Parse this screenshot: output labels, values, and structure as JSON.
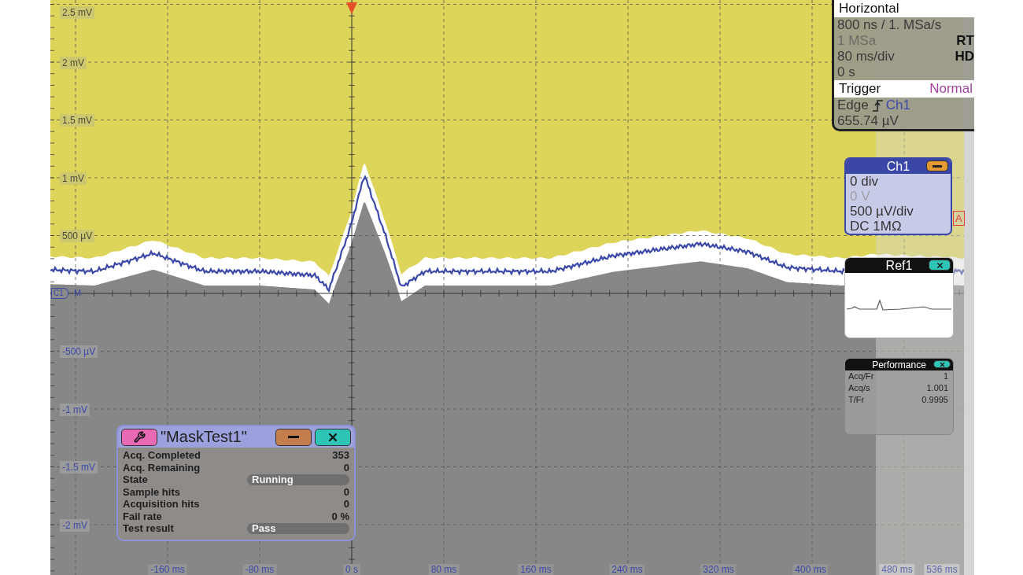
{
  "display": {
    "y_labels_upper": [
      "2.5 mV",
      "2 mV",
      "1.5 mV",
      "1 mV",
      "500 µV"
    ],
    "y_labels_lower": [
      "-500 µV",
      "-1 mV",
      "-1.5 mV",
      "-2 mV"
    ],
    "x_labels": [
      {
        "text": "-160 ms",
        "dim": false
      },
      {
        "text": "-80 ms",
        "dim": false
      },
      {
        "text": "0 s",
        "dim": false
      },
      {
        "text": "80 ms",
        "dim": false
      },
      {
        "text": "160 ms",
        "dim": false
      },
      {
        "text": "240 ms",
        "dim": false
      },
      {
        "text": "320 ms",
        "dim": false
      },
      {
        "text": "400 ms",
        "dim": false
      },
      {
        "text": "480 ms",
        "dim": true
      },
      {
        "text": "536 ms",
        "dim": true
      }
    ],
    "channel_marker": "C1",
    "ground_marker": "M",
    "trigger_marker": "A"
  },
  "horizontal": {
    "title": "Horizontal",
    "rows": [
      {
        "left": "800 ns / 1. MSa/s",
        "dim": false
      },
      {
        "left": "1 MSa",
        "right": "RT",
        "dim": true
      },
      {
        "left": "80 ms/div",
        "right": "HD",
        "dim": false
      },
      {
        "left": "0 s",
        "dim": false
      }
    ]
  },
  "trigger": {
    "title": "Trigger",
    "mode": "Normal",
    "type": "Edge",
    "source": "Ch1",
    "threshold": "655.74 µV"
  },
  "ch1": {
    "title": "Ch1",
    "rows": [
      {
        "text": "0 div",
        "dim": false
      },
      {
        "text": "0 V",
        "dim": true
      },
      {
        "text": "500 µV/div",
        "dim": false
      },
      {
        "text": "DC 1MΩ",
        "dim": false
      }
    ]
  },
  "ref1": {
    "title": "Ref1"
  },
  "performance": {
    "title": "Performance",
    "rows": [
      {
        "label": "Acq/Fr",
        "value": "1"
      },
      {
        "label": "Acq/s",
        "value": "1.001"
      },
      {
        "label": "T/Fr",
        "value": "0.9995"
      }
    ]
  },
  "mask_test": {
    "title": "\"MaskTest1\"",
    "rows": [
      {
        "label": "Acq. Completed",
        "value": "353",
        "kind": "value"
      },
      {
        "label": "Acq. Remaining",
        "value": "0",
        "kind": "value"
      },
      {
        "label": "State",
        "value": "Running",
        "kind": "status"
      },
      {
        "label": "Sample hits",
        "value": "0",
        "kind": "value"
      },
      {
        "label": "Acquisition hits",
        "value": "0",
        "kind": "value"
      },
      {
        "label": "Fail rate",
        "value": "0 %",
        "kind": "value"
      },
      {
        "label": "Test result",
        "value": "Pass",
        "kind": "status"
      }
    ]
  }
}
